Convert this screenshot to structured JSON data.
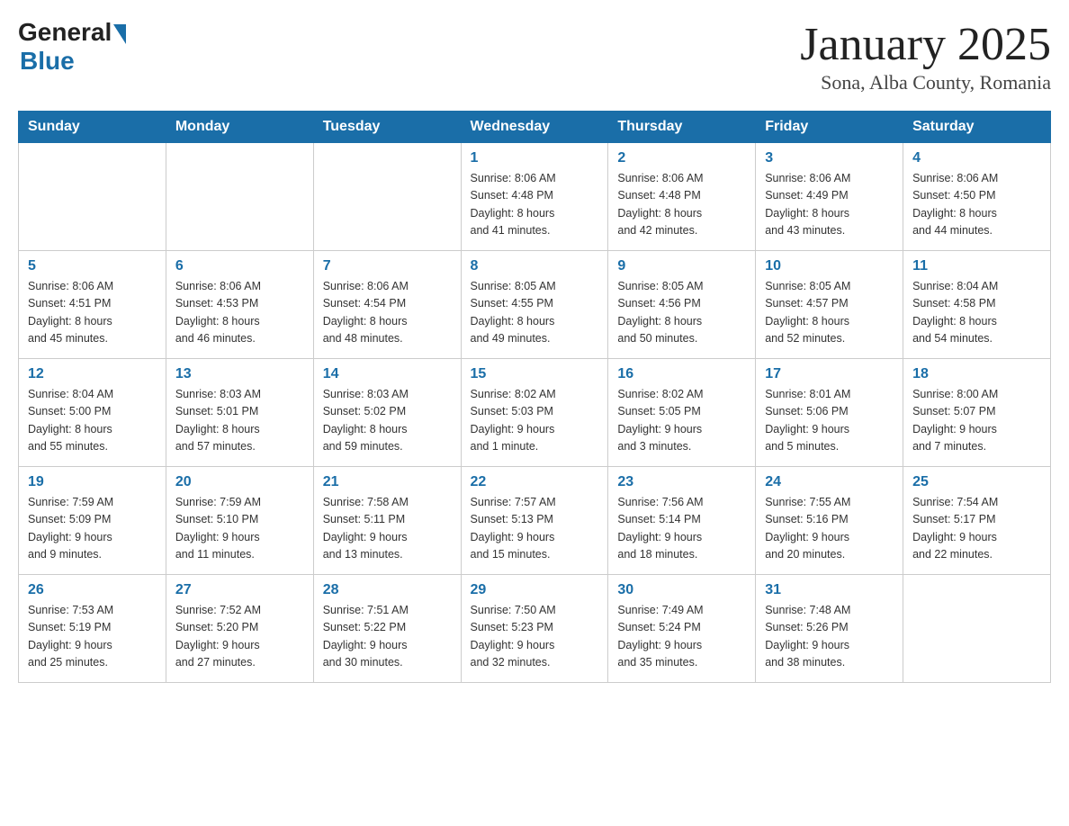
{
  "logo": {
    "general": "General",
    "blue": "Blue"
  },
  "title": "January 2025",
  "location": "Sona, Alba County, Romania",
  "headers": [
    "Sunday",
    "Monday",
    "Tuesday",
    "Wednesday",
    "Thursday",
    "Friday",
    "Saturday"
  ],
  "weeks": [
    [
      {
        "day": "",
        "info": ""
      },
      {
        "day": "",
        "info": ""
      },
      {
        "day": "",
        "info": ""
      },
      {
        "day": "1",
        "info": "Sunrise: 8:06 AM\nSunset: 4:48 PM\nDaylight: 8 hours\nand 41 minutes."
      },
      {
        "day": "2",
        "info": "Sunrise: 8:06 AM\nSunset: 4:48 PM\nDaylight: 8 hours\nand 42 minutes."
      },
      {
        "day": "3",
        "info": "Sunrise: 8:06 AM\nSunset: 4:49 PM\nDaylight: 8 hours\nand 43 minutes."
      },
      {
        "day": "4",
        "info": "Sunrise: 8:06 AM\nSunset: 4:50 PM\nDaylight: 8 hours\nand 44 minutes."
      }
    ],
    [
      {
        "day": "5",
        "info": "Sunrise: 8:06 AM\nSunset: 4:51 PM\nDaylight: 8 hours\nand 45 minutes."
      },
      {
        "day": "6",
        "info": "Sunrise: 8:06 AM\nSunset: 4:53 PM\nDaylight: 8 hours\nand 46 minutes."
      },
      {
        "day": "7",
        "info": "Sunrise: 8:06 AM\nSunset: 4:54 PM\nDaylight: 8 hours\nand 48 minutes."
      },
      {
        "day": "8",
        "info": "Sunrise: 8:05 AM\nSunset: 4:55 PM\nDaylight: 8 hours\nand 49 minutes."
      },
      {
        "day": "9",
        "info": "Sunrise: 8:05 AM\nSunset: 4:56 PM\nDaylight: 8 hours\nand 50 minutes."
      },
      {
        "day": "10",
        "info": "Sunrise: 8:05 AM\nSunset: 4:57 PM\nDaylight: 8 hours\nand 52 minutes."
      },
      {
        "day": "11",
        "info": "Sunrise: 8:04 AM\nSunset: 4:58 PM\nDaylight: 8 hours\nand 54 minutes."
      }
    ],
    [
      {
        "day": "12",
        "info": "Sunrise: 8:04 AM\nSunset: 5:00 PM\nDaylight: 8 hours\nand 55 minutes."
      },
      {
        "day": "13",
        "info": "Sunrise: 8:03 AM\nSunset: 5:01 PM\nDaylight: 8 hours\nand 57 minutes."
      },
      {
        "day": "14",
        "info": "Sunrise: 8:03 AM\nSunset: 5:02 PM\nDaylight: 8 hours\nand 59 minutes."
      },
      {
        "day": "15",
        "info": "Sunrise: 8:02 AM\nSunset: 5:03 PM\nDaylight: 9 hours\nand 1 minute."
      },
      {
        "day": "16",
        "info": "Sunrise: 8:02 AM\nSunset: 5:05 PM\nDaylight: 9 hours\nand 3 minutes."
      },
      {
        "day": "17",
        "info": "Sunrise: 8:01 AM\nSunset: 5:06 PM\nDaylight: 9 hours\nand 5 minutes."
      },
      {
        "day": "18",
        "info": "Sunrise: 8:00 AM\nSunset: 5:07 PM\nDaylight: 9 hours\nand 7 minutes."
      }
    ],
    [
      {
        "day": "19",
        "info": "Sunrise: 7:59 AM\nSunset: 5:09 PM\nDaylight: 9 hours\nand 9 minutes."
      },
      {
        "day": "20",
        "info": "Sunrise: 7:59 AM\nSunset: 5:10 PM\nDaylight: 9 hours\nand 11 minutes."
      },
      {
        "day": "21",
        "info": "Sunrise: 7:58 AM\nSunset: 5:11 PM\nDaylight: 9 hours\nand 13 minutes."
      },
      {
        "day": "22",
        "info": "Sunrise: 7:57 AM\nSunset: 5:13 PM\nDaylight: 9 hours\nand 15 minutes."
      },
      {
        "day": "23",
        "info": "Sunrise: 7:56 AM\nSunset: 5:14 PM\nDaylight: 9 hours\nand 18 minutes."
      },
      {
        "day": "24",
        "info": "Sunrise: 7:55 AM\nSunset: 5:16 PM\nDaylight: 9 hours\nand 20 minutes."
      },
      {
        "day": "25",
        "info": "Sunrise: 7:54 AM\nSunset: 5:17 PM\nDaylight: 9 hours\nand 22 minutes."
      }
    ],
    [
      {
        "day": "26",
        "info": "Sunrise: 7:53 AM\nSunset: 5:19 PM\nDaylight: 9 hours\nand 25 minutes."
      },
      {
        "day": "27",
        "info": "Sunrise: 7:52 AM\nSunset: 5:20 PM\nDaylight: 9 hours\nand 27 minutes."
      },
      {
        "day": "28",
        "info": "Sunrise: 7:51 AM\nSunset: 5:22 PM\nDaylight: 9 hours\nand 30 minutes."
      },
      {
        "day": "29",
        "info": "Sunrise: 7:50 AM\nSunset: 5:23 PM\nDaylight: 9 hours\nand 32 minutes."
      },
      {
        "day": "30",
        "info": "Sunrise: 7:49 AM\nSunset: 5:24 PM\nDaylight: 9 hours\nand 35 minutes."
      },
      {
        "day": "31",
        "info": "Sunrise: 7:48 AM\nSunset: 5:26 PM\nDaylight: 9 hours\nand 38 minutes."
      },
      {
        "day": "",
        "info": ""
      }
    ]
  ]
}
